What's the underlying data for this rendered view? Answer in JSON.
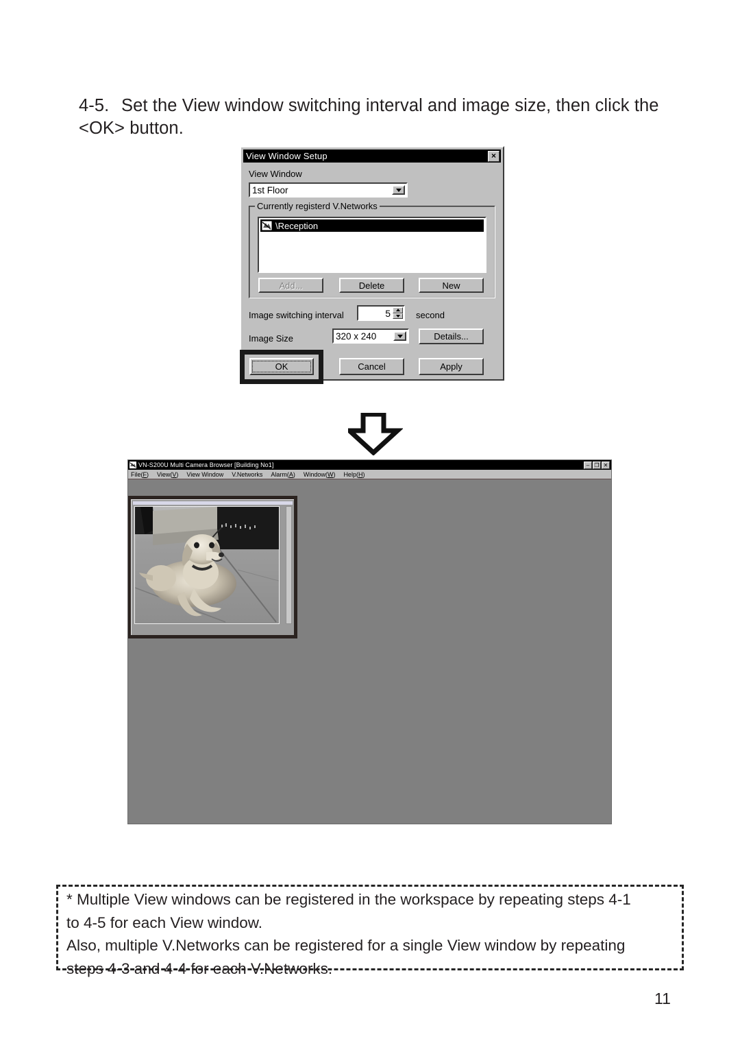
{
  "step": {
    "number": "4-5.",
    "text": "Set the View window switching interval and image size, then click the <OK> button."
  },
  "dialog": {
    "title": "View Window Setup",
    "close_label": "×",
    "view_window_label": "View Window",
    "view_window_value": "1st Floor",
    "group_label": "Currently registerd V.Networks",
    "list_items": [
      "\\Reception"
    ],
    "buttons": {
      "add": "Add...",
      "delete": "Delete",
      "new": "New",
      "ok": "OK",
      "cancel": "Cancel",
      "apply": "Apply",
      "details": "Details..."
    },
    "interval_label": "Image switching interval",
    "interval_value": "5",
    "interval_unit": "second",
    "image_size_label": "Image Size",
    "image_size_value": "320 x 240"
  },
  "arrow": {
    "name": "down-arrow"
  },
  "browser": {
    "title": "VN-S200U Multi Camera Browser [Building No1]",
    "window_buttons": [
      "–",
      "❐",
      "✕"
    ],
    "menu": [
      {
        "label": "File(",
        "key": "F",
        "suffix": ")"
      },
      {
        "label": "View(",
        "key": "V",
        "suffix": ")"
      },
      {
        "label": "View Window",
        "key": "",
        "suffix": ""
      },
      {
        "label": "V.Networks",
        "key": "",
        "suffix": ""
      },
      {
        "label": "Alarm(",
        "key": "A",
        "suffix": ")"
      },
      {
        "label": "Window(",
        "key": "W",
        "suffix": ")"
      },
      {
        "label": "Help(",
        "key": "H",
        "suffix": ")"
      }
    ]
  },
  "note": {
    "line1": "* Multiple View windows can be registered in the workspace by repeating steps 4-1",
    "line2": "to 4-5 for each View window.",
    "line3": "Also, multiple V.Networks can be registered for a single View window by repeating",
    "line4": "steps 4-3 and 4-4 for each V.Networks."
  },
  "page_number": "11",
  "colors": {
    "dialog_face": "#c0c0c0",
    "titlebar": "#000000",
    "client_area": "#808080",
    "highlight_frame": "#1a1a1a",
    "text": "#231f20"
  }
}
